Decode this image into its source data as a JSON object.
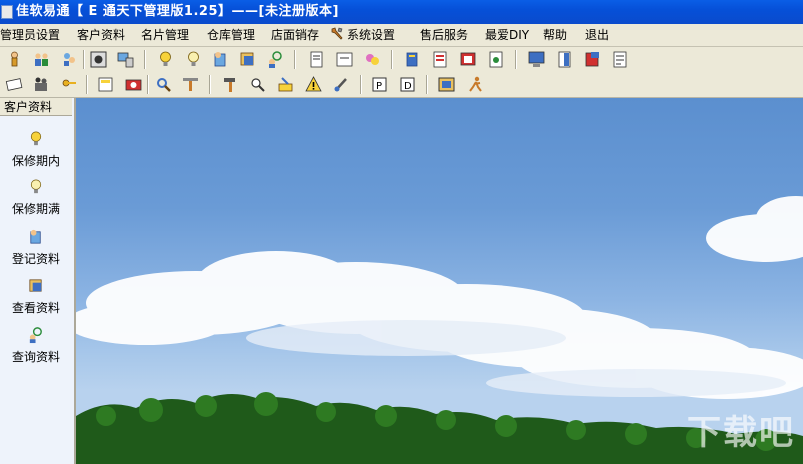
{
  "window": {
    "title": "佳软易通【 E 通天下管理版1.25】——[未注册版本]"
  },
  "menu": [
    {
      "label": "管理员设置"
    },
    {
      "label": "客户资料"
    },
    {
      "label": "名片管理"
    },
    {
      "label": "仓库管理"
    },
    {
      "label": "店面销存"
    },
    {
      "label": "系统设置",
      "icon": "wrench-icon"
    },
    {
      "label": "售后服务"
    },
    {
      "label": "最爱DIY"
    },
    {
      "label": "帮助"
    },
    {
      "label": "退出"
    }
  ],
  "toolbar_row1_icons": [
    "person-icon",
    "users-icon",
    "group-icon",
    "cd-icon",
    "pc-icon",
    "bulb-yellow-icon",
    "bulb-icon",
    "register-icon",
    "view-icon",
    "search-person-icon",
    "note-icon",
    "calendar-icon",
    "color-icon",
    "book-icon",
    "list-icon",
    "window-icon",
    "doc-icon",
    "monitor-icon",
    "door-icon",
    "red-book-icon",
    "report-icon"
  ],
  "toolbar_row2_icons": [
    "card-icon",
    "people-icon",
    "key-icon",
    "calculator-icon",
    "camera-icon",
    "magnifier-icon",
    "tools-icon",
    "hammer-icon",
    "search-doc-icon",
    "cleanup-icon",
    "warning-icon",
    "brush-icon",
    "p-icon",
    "d-icon",
    "frame-icon",
    "runner-icon"
  ],
  "sidebar": {
    "header": "客户资料",
    "items": [
      {
        "label": "保修期内",
        "icon": "bulb-yellow-icon"
      },
      {
        "label": "保修期满",
        "icon": "bulb-icon"
      },
      {
        "label": "登记资料",
        "icon": "register-icon"
      },
      {
        "label": "查看资料",
        "icon": "view-icon"
      },
      {
        "label": "查询资料",
        "icon": "search-person-icon"
      }
    ]
  },
  "watermark": {
    "text": "下载吧"
  }
}
